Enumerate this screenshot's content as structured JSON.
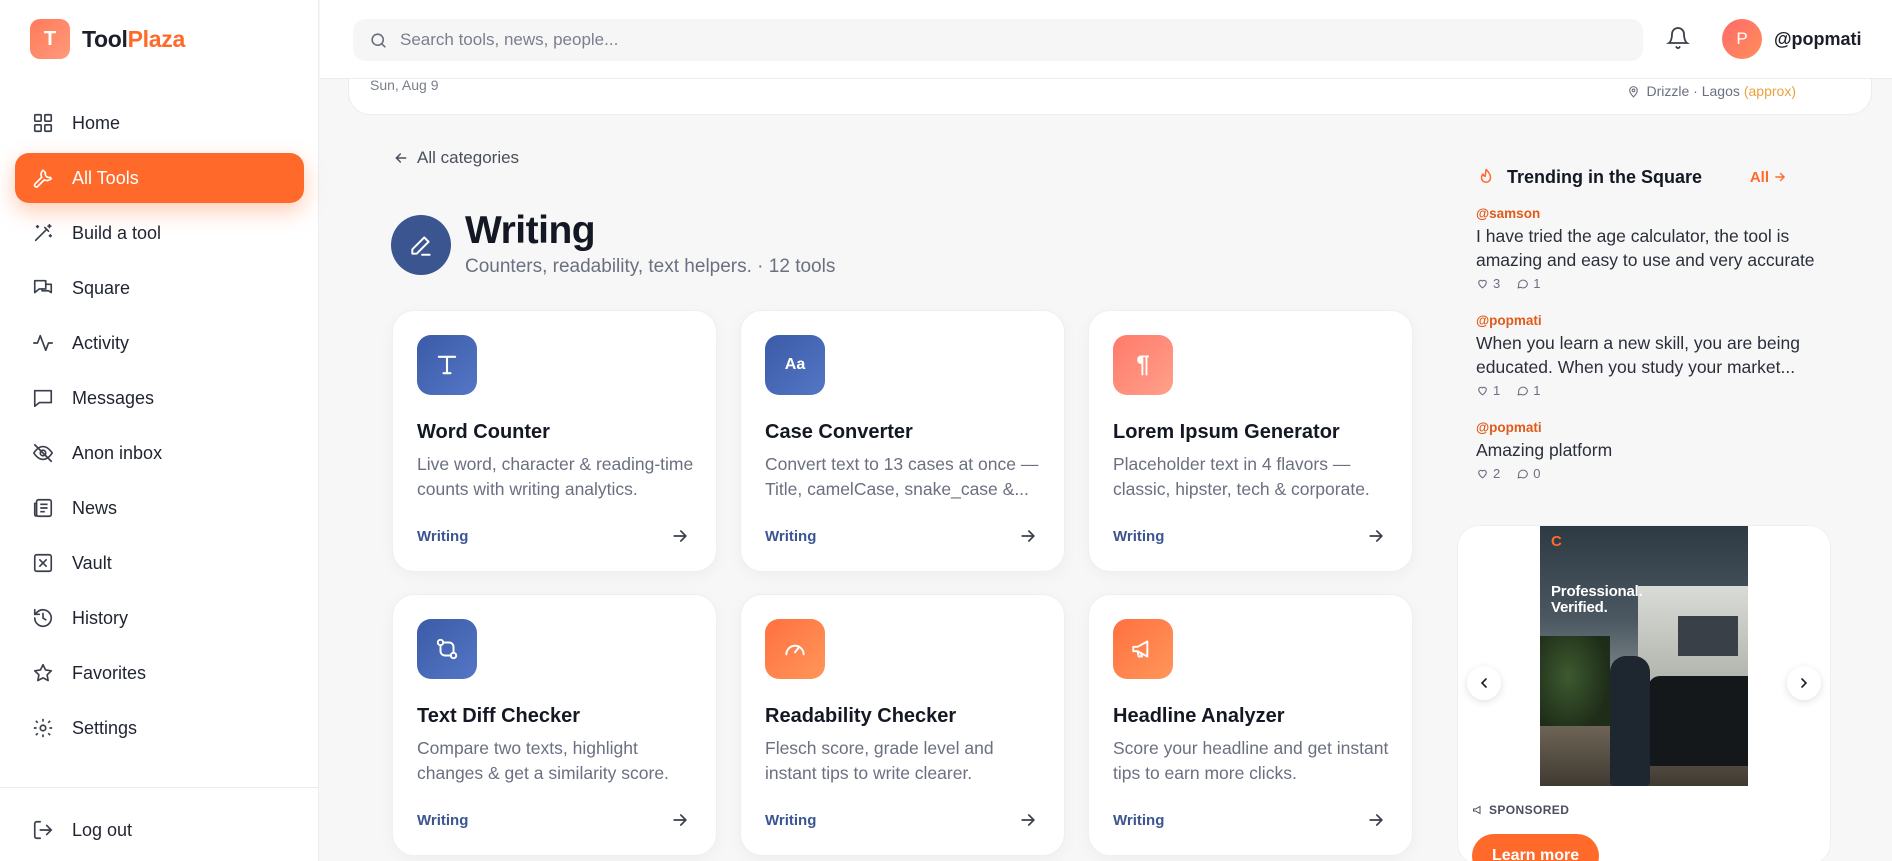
{
  "brand": {
    "badge": "T",
    "name_part1": "Tool",
    "name_part2": "Plaza"
  },
  "sidebar": {
    "items": [
      {
        "label": "Home",
        "icon": "grid-icon"
      },
      {
        "label": "All Tools",
        "icon": "wrench-icon",
        "active": true
      },
      {
        "label": "Build a tool",
        "icon": "magic-wand-icon"
      },
      {
        "label": "Square",
        "icon": "chat-bubbles-icon"
      },
      {
        "label": "Activity",
        "icon": "activity-icon"
      },
      {
        "label": "Messages",
        "icon": "message-icon"
      },
      {
        "label": "Anon inbox",
        "icon": "eye-off-icon"
      },
      {
        "label": "News",
        "icon": "newspaper-icon"
      },
      {
        "label": "Vault",
        "icon": "vault-icon"
      },
      {
        "label": "History",
        "icon": "history-icon"
      },
      {
        "label": "Favorites",
        "icon": "star-icon"
      },
      {
        "label": "Settings",
        "icon": "gear-icon"
      }
    ],
    "logout_label": "Log out"
  },
  "topbar": {
    "search_placeholder": "Search tools, news, people...",
    "avatar_letter": "P",
    "username": "@popmati"
  },
  "datestrip": {
    "date": "Sun, Aug 9",
    "location": "Drizzle · Lagos",
    "approx": "(approx)"
  },
  "main": {
    "back_label": "All categories",
    "category_title": "Writing",
    "category_subtitle": "Counters, readability, text helpers. · 12 tools",
    "tools": [
      {
        "title": "Word Counter",
        "desc": "Live word, character & reading-time counts with writing analytics.",
        "tag": "Writing",
        "icon": "text-t-icon",
        "color": "blue"
      },
      {
        "title": "Case Converter",
        "desc": "Convert text to 13 cases at once — Title, camelCase, snake_case &...",
        "tag": "Writing",
        "icon": "case-aa-icon",
        "color": "blue"
      },
      {
        "title": "Lorem Ipsum Generator",
        "desc": "Placeholder text in 4 flavors — classic, hipster, tech & corporate.",
        "tag": "Writing",
        "icon": "pilcrow-icon",
        "color": "salmon"
      },
      {
        "title": "Text Diff Checker",
        "desc": "Compare two texts, highlight changes & get a similarity score.",
        "tag": "Writing",
        "icon": "git-compare-icon",
        "color": "blue"
      },
      {
        "title": "Readability Checker",
        "desc": "Flesch score, grade level and instant tips to write clearer.",
        "tag": "Writing",
        "icon": "gauge-icon",
        "color": "orange"
      },
      {
        "title": "Headline Analyzer",
        "desc": "Score your headline and get instant tips to earn more clicks.",
        "tag": "Writing",
        "icon": "megaphone-icon",
        "color": "orange"
      }
    ]
  },
  "trending": {
    "title": "Trending in the Square",
    "all_label": "All",
    "posts": [
      {
        "handle": "@samson",
        "text": "I have tried the age calculator, the tool is amazing and easy to use and very accurate",
        "likes": "3",
        "comments": "1"
      },
      {
        "handle": "@popmati",
        "text": "When you learn a new skill, you are being educated. When you study your market...",
        "likes": "1",
        "comments": "1"
      },
      {
        "handle": "@popmati",
        "text": "Amazing platform",
        "likes": "2",
        "comments": "0"
      }
    ]
  },
  "sponsored": {
    "ad_logo": "C",
    "ad_slogan_line1": "Professional.",
    "ad_slogan_line2": "Verified.",
    "label": "SPONSORED",
    "cta": "Learn more"
  },
  "colors": {
    "accent": "#ff6a2b",
    "category_blue": "#3b5591"
  }
}
